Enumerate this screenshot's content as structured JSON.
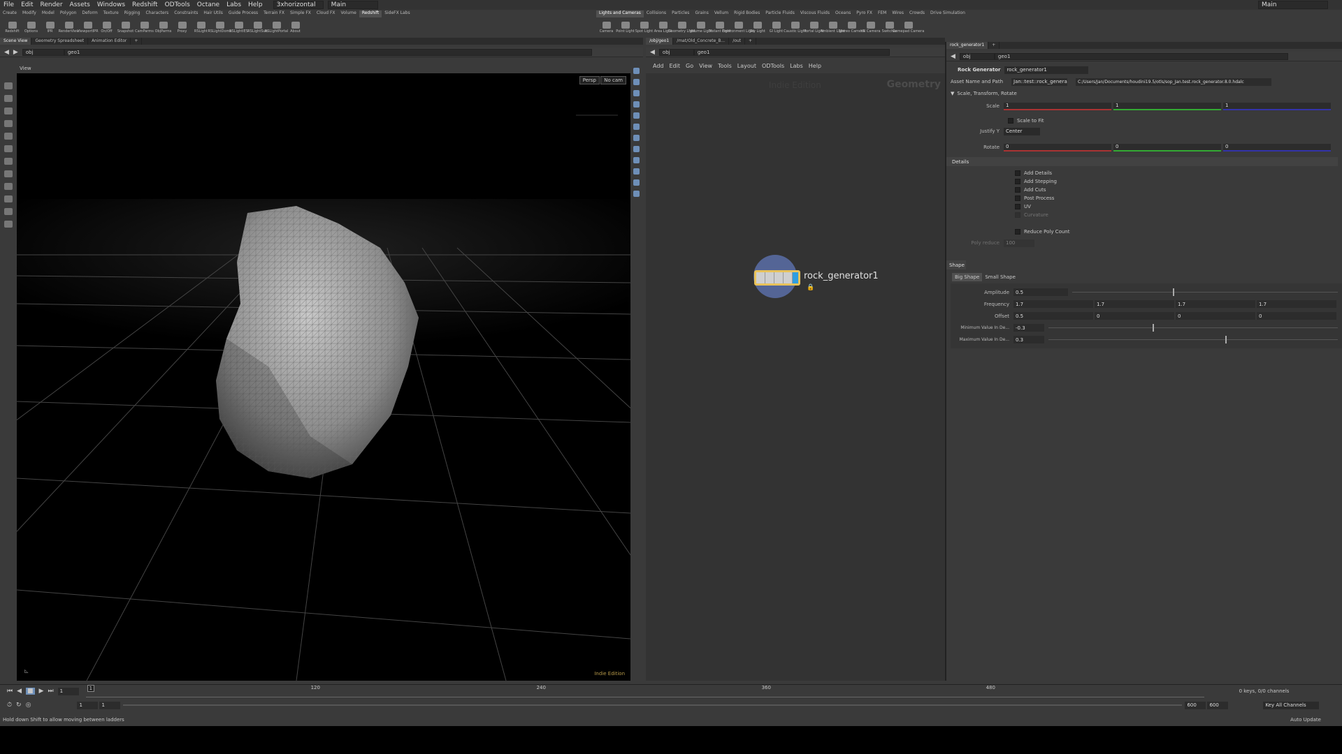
{
  "menubar": {
    "items": [
      "File",
      "Edit",
      "Render",
      "Assets",
      "Windows",
      "Redshift",
      "ODTools",
      "Octane",
      "Labs",
      "Help"
    ],
    "desktop": "3xhorizontal",
    "context": "Main",
    "right_context": "Main"
  },
  "shelf_left": {
    "tabs": [
      "Create",
      "Modify",
      "Model",
      "Polygon",
      "Deform",
      "Texture",
      "Rigging",
      "Characters",
      "Constraints",
      "Hair Utils",
      "Guide Process",
      "Terrain FX",
      "Simple FX",
      "Cloud FX",
      "Volume",
      "Redshift",
      "SideFX Labs"
    ],
    "active_tab": "Redshift",
    "tools": [
      "Redshift",
      "Options",
      "IPR",
      "RenderView",
      "ViewportIPR",
      "On/Off",
      "Snapshot",
      "CamParms",
      "ObjParms",
      "Proxy",
      "RSLight",
      "RSLightDome",
      "RSLightIES",
      "RSLightSun",
      "RSLightPortal",
      "About"
    ]
  },
  "shelf_right": {
    "tabs": [
      "Lights and Cameras",
      "Collisions",
      "Particles",
      "Grains",
      "Vellum",
      "Rigid Bodies",
      "Particle Fluids",
      "Viscous Fluids",
      "Oceans",
      "Pyro FX",
      "FEM",
      "Wires",
      "Crowds",
      "Drive Simulation"
    ],
    "active_tab": "Lights and Cameras",
    "tools": [
      "Camera",
      "Point Light",
      "Spot Light",
      "Area Light",
      "Geometry Light",
      "Volume Light",
      "Distant Light",
      "Environment Light",
      "Sky Light",
      "GI Light",
      "Caustic Light",
      "Portal Light",
      "Ambient Light",
      "Stereo Camera",
      "VR Camera",
      "Switcher",
      "Gamepad Camera"
    ]
  },
  "left_pane": {
    "tabs": [
      "Scene View",
      "Geometry Spreadsheet",
      "Animation Editor"
    ],
    "path": [
      "obj",
      "geo1"
    ],
    "view_label": "View",
    "persp": "Persp",
    "cam": "No cam",
    "edition": "Indie Edition"
  },
  "network_pane": {
    "tabs": [
      "/obj/geo1",
      "/mat/Old_Concrete_B...",
      "/out"
    ],
    "path": [
      "obj",
      "geo1"
    ],
    "menu": [
      "Add",
      "Edit",
      "Go",
      "View",
      "Tools",
      "Layout",
      "ODTools",
      "Labs",
      "Help"
    ],
    "watermark": "Indie Edition",
    "context_label": "Geometry",
    "node_name": "rock_generator1"
  },
  "params": {
    "tabs": [
      "rock_generator1"
    ],
    "path": [
      "obj",
      "geo1"
    ],
    "node_type": "Rock Generator",
    "node_name": "rock_generator1",
    "asset_label": "Asset Name and Path",
    "asset_name": "Jan::test::rock_genera",
    "asset_path": "C:/Users/Jan/Documents/houdini19.5/otls/sop_Jan.test.rock_generator.8.0.hdalc",
    "section1": "Scale, Transform, Rotate",
    "scale_label": "Scale",
    "scale": [
      "1",
      "1",
      "1"
    ],
    "scale_to_fit": "Scale to Fit",
    "justify_label": "Justify Y",
    "justify_value": "Center",
    "rotate_label": "Rotate",
    "rotate": [
      "0",
      "0",
      "0"
    ],
    "details_title": "Details",
    "details": [
      "Add Details",
      "Add Stepping",
      "Add Cuts",
      "Post Process",
      "UV",
      "Curvature"
    ],
    "reduce": "Reduce Poly Count",
    "poly_reduce_label": "Poly reduce",
    "poly_reduce_value": "100",
    "shape_title": "Shape",
    "shape_tabs": [
      "Big Shape",
      "Small Shape"
    ],
    "amplitude_label": "Amplitude",
    "amplitude": "0.5",
    "frequency_label": "Frequency",
    "frequency": [
      "1.7",
      "1.7",
      "1.7",
      "1.7"
    ],
    "offset_label": "Offset",
    "offset": [
      "0.5",
      "0",
      "0",
      "0"
    ],
    "min_label": "Minimum Value In De...",
    "min_value": "-0.3",
    "max_label": "Maximum Value In De...",
    "max_value": "0.3"
  },
  "timeline": {
    "frame": "1",
    "ticks": [
      "1",
      "120",
      "240",
      "360",
      "480"
    ],
    "start": "1",
    "start2": "1",
    "end": "600",
    "end2": "600",
    "keys_info": "0 keys, 0/0 channels",
    "key_all": "Key All Channels",
    "auto_update": "Auto Update"
  },
  "status": "Hold down Shift to allow moving between ladders"
}
